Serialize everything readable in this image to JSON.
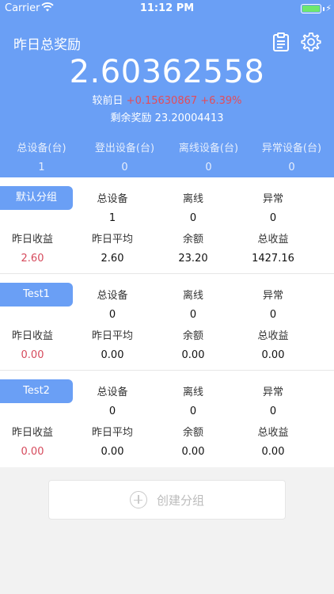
{
  "status_bar": {
    "carrier": "Carrier",
    "time": "11:12 PM"
  },
  "header": {
    "title": "昨日总奖励",
    "total_value": "2.60362558",
    "compare_label": "较前日",
    "compare_delta": "+0.15630867",
    "compare_percent": "+6.39%",
    "remaining_label": "剩余奖励",
    "remaining_value": "23.20004413",
    "stats": [
      {
        "label": "总设备(台)",
        "value": "1"
      },
      {
        "label": "登出设备(台)",
        "value": "0"
      },
      {
        "label": "离线设备(台)",
        "value": "0"
      },
      {
        "label": "异常设备(台)",
        "value": "0"
      }
    ]
  },
  "groups": [
    {
      "name": "默认分组",
      "total_label": "总设备",
      "total": "1",
      "offline_label": "离线",
      "offline": "0",
      "abnormal_label": "异常",
      "abnormal": "0",
      "yesterday_label": "昨日收益",
      "yesterday": "2.60",
      "avg_label": "昨日平均",
      "avg": "2.60",
      "balance_label": "余额",
      "balance": "23.20",
      "income_label": "总收益",
      "income": "1427.16"
    },
    {
      "name": "Test1",
      "total_label": "总设备",
      "total": "0",
      "offline_label": "离线",
      "offline": "0",
      "abnormal_label": "异常",
      "abnormal": "0",
      "yesterday_label": "昨日收益",
      "yesterday": "0.00",
      "avg_label": "昨日平均",
      "avg": "0.00",
      "balance_label": "余额",
      "balance": "0.00",
      "income_label": "总收益",
      "income": "0.00"
    },
    {
      "name": "Test2",
      "total_label": "总设备",
      "total": "0",
      "offline_label": "离线",
      "offline": "0",
      "abnormal_label": "异常",
      "abnormal": "0",
      "yesterday_label": "昨日收益",
      "yesterday": "0.00",
      "avg_label": "昨日平均",
      "avg": "0.00",
      "balance_label": "余额",
      "balance": "0.00",
      "income_label": "总收益",
      "income": "0.00"
    }
  ],
  "create_group_label": "创建分组",
  "colors": {
    "primary": "#6a9ff5",
    "red": "#d64a5c",
    "battery": "#6ee86e"
  },
  "icons": {
    "clipboard": "clipboard-icon",
    "settings": "gear-icon",
    "add": "plus-circle-icon",
    "wifi": "wifi-icon",
    "battery": "battery-icon"
  }
}
